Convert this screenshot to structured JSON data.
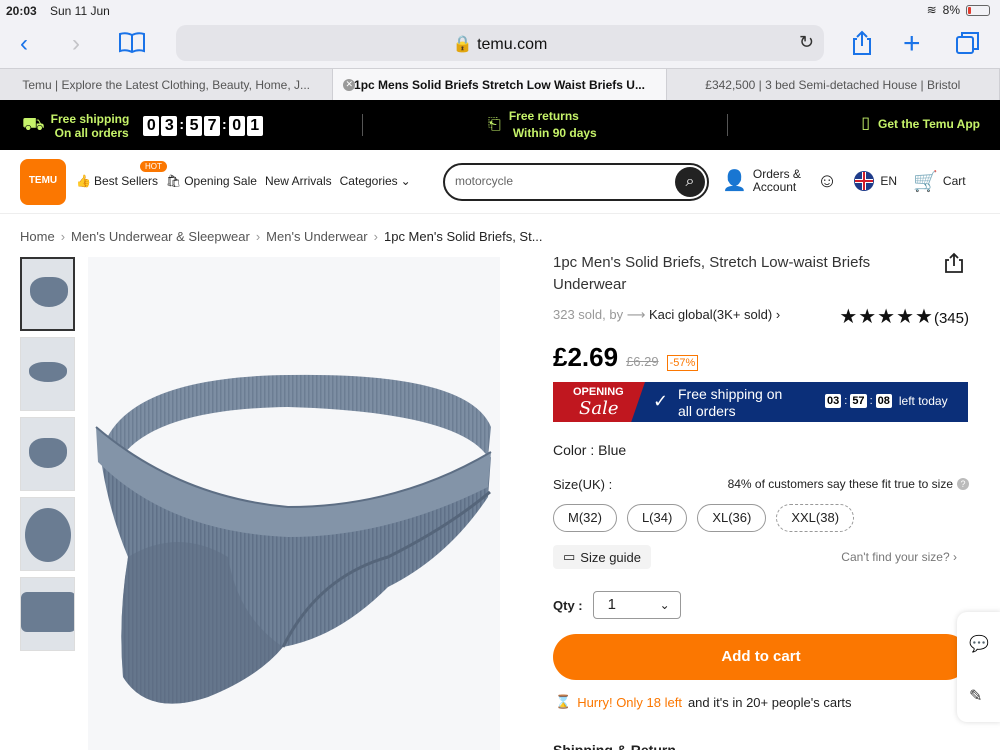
{
  "status": {
    "time": "20:03",
    "date": "Sun 11 Jun",
    "battery": "8%"
  },
  "browser": {
    "url": "temu.com",
    "tabs": [
      {
        "label": "Temu | Explore the Latest Clothing, Beauty, Home, J..."
      },
      {
        "label": "1pc Mens Solid Briefs Stretch Low Waist Briefs U..."
      },
      {
        "label": "£342,500 | 3 bed Semi-detached House | Bristol"
      }
    ]
  },
  "promo": {
    "free_shipping": "Free shipping",
    "on_all_orders": "On all orders",
    "timer": [
      "0",
      "3",
      "5",
      "7",
      "0",
      "1"
    ],
    "returns": "Free returns",
    "returns_sub": "Within 90 days",
    "app": "Get the Temu App"
  },
  "header": {
    "logo": "TEMU",
    "nav": {
      "best_sellers": "Best Sellers",
      "hot": "HOT",
      "opening_sale": "Opening Sale",
      "new_arrivals": "New Arrivals",
      "categories": "Categories"
    },
    "search_value": "motorcycle",
    "orders": "Orders &",
    "account": "Account",
    "language": "EN",
    "cart": "Cart"
  },
  "breadcrumb": [
    "Home",
    "Men's Underwear & Sleepwear",
    "Men's Underwear",
    "1pc Men's Solid Briefs, St..."
  ],
  "product": {
    "title": "1pc Men's Solid Briefs, Stretch Low-waist Briefs Underwear",
    "sold": "323 sold, by",
    "seller": "Kaci global(3K+ sold)",
    "rating_count": "(345)",
    "rating": 5,
    "price": "£2.69",
    "old_price": "£6.29",
    "discount": "-57%",
    "banner": {
      "opening": "OPENING",
      "sale": "Sale",
      "line1": "Free shipping on",
      "line2": "all orders",
      "t1": "03",
      "t2": "57",
      "t3": "08",
      "left_today": "left today"
    },
    "color": "Color : Blue",
    "size_label": "Size(UK) :",
    "fit_text": "84% of customers say these fit true to size",
    "sizes": [
      "M(32)",
      "L(34)",
      "XL(36)",
      "XXL(38)"
    ],
    "size_guide": "Size guide",
    "cant_find": "Can't find your size?",
    "qty_label": "Qty :",
    "qty": "1",
    "add_to_cart": "Add to cart",
    "hurry": "Hurry! Only 18 left",
    "hurry_rest": "and it's in 20+ people's carts",
    "shipping_return": "Shipping & Return"
  },
  "colors": {
    "accent": "#fb7701",
    "banner": "#0b2f79",
    "promo_green": "#c6f36a"
  }
}
